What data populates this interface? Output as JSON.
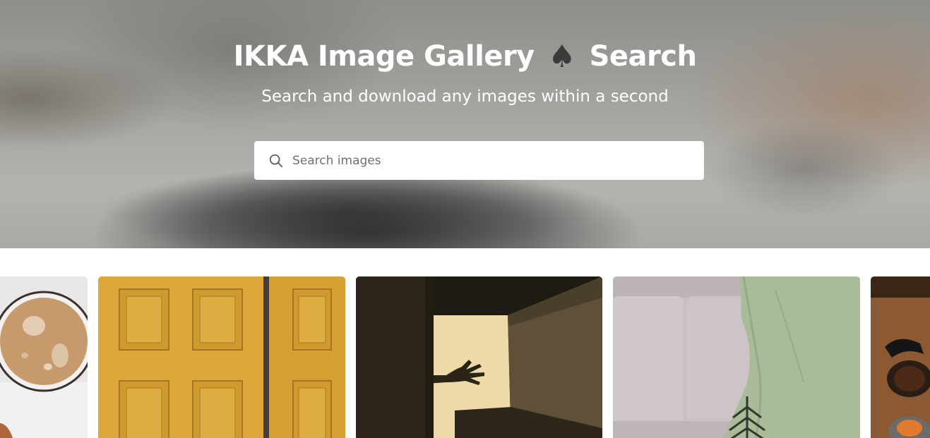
{
  "hero": {
    "title_part1": "IKKA Image Gallery",
    "title_symbol": "♠",
    "title_part2": "Search",
    "subtitle": "Search and download any images within a second"
  },
  "search": {
    "placeholder": "Search images",
    "value": "",
    "icon": "search-icon"
  },
  "gallery": {
    "images": [
      {
        "subject": "coffee-cup"
      },
      {
        "subject": "yellow-door"
      },
      {
        "subject": "hand-shadow"
      },
      {
        "subject": "sofa-blanket"
      },
      {
        "subject": "kitchen-pans"
      }
    ]
  },
  "colors": {
    "title_text": "#ffffff",
    "spade": "#3b3b3b",
    "search_bg": "#ffffff",
    "placeholder": "#707070"
  }
}
